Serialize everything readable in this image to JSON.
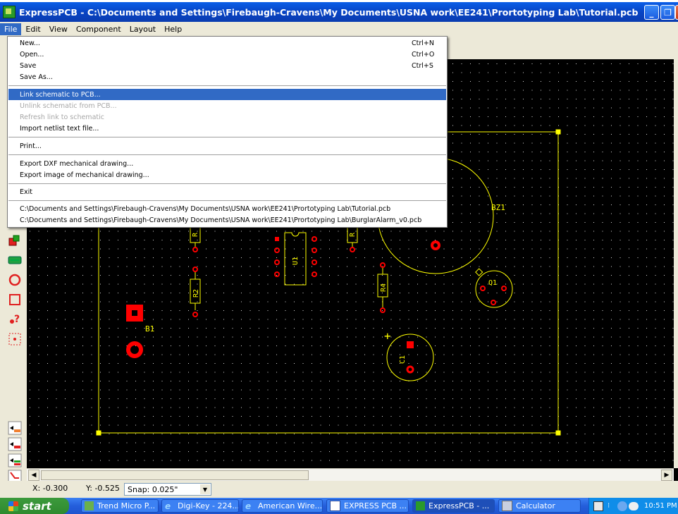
{
  "window": {
    "title": "ExpressPCB - C:\\Documents and Settings\\Firebaugh-Cravens\\My Documents\\USNA work\\EE241\\Prortotyping Lab\\Tutorial.pcb",
    "min_glyph": "_",
    "max_glyph": "❐",
    "close_glyph": "✕"
  },
  "menubar": {
    "items": [
      "File",
      "Edit",
      "View",
      "Component",
      "Layout",
      "Help"
    ]
  },
  "file_menu": {
    "items": [
      {
        "label": "New...",
        "shortcut": "Ctrl+N",
        "state": "normal"
      },
      {
        "label": "Open...",
        "shortcut": "Ctrl+O",
        "state": "normal"
      },
      {
        "label": "Save",
        "shortcut": "Ctrl+S",
        "state": "normal"
      },
      {
        "label": "Save As...",
        "shortcut": "",
        "state": "normal"
      },
      {
        "label": "Link schematic to PCB...",
        "shortcut": "",
        "state": "highlighted"
      },
      {
        "label": "Unlink schematic from PCB...",
        "shortcut": "",
        "state": "disabled"
      },
      {
        "label": "Refresh link to schematic",
        "shortcut": "",
        "state": "disabled"
      },
      {
        "label": "Import netlist text file...",
        "shortcut": "",
        "state": "normal"
      },
      {
        "label": "Print...",
        "shortcut": "",
        "state": "normal"
      },
      {
        "label": "Export DXF mechanical drawing...",
        "shortcut": "",
        "state": "normal"
      },
      {
        "label": "Export image of mechanical drawing...",
        "shortcut": "",
        "state": "normal"
      },
      {
        "label": "Exit",
        "shortcut": "",
        "state": "normal"
      },
      {
        "label": "C:\\Documents and Settings\\Firebaugh-Cravens\\My Documents\\USNA work\\EE241\\Prortotyping Lab\\Tutorial.pcb",
        "shortcut": "",
        "state": "normal"
      },
      {
        "label": "C:\\Documents and Settings\\Firebaugh-Cravens\\My Documents\\USNA work\\EE241\\Prortotyping Lab\\BurglarAlarm_v0.pcb",
        "shortcut": "",
        "state": "normal"
      }
    ]
  },
  "pcb": {
    "labels": {
      "bz1": "BZ1",
      "r2": "R2",
      "r4": "R4",
      "u1": "U1",
      "q1": "Q1",
      "c1": "C1",
      "b1": "B1",
      "r_left": "R",
      "r_right": "R",
      "plus": "+"
    },
    "colors": {
      "silkscreen": "#ffff00",
      "pad": "#ff0000",
      "grid": "#d8d8d8",
      "background": "#000000"
    }
  },
  "status": {
    "x": "X: -0.300",
    "y": "Y: -0.525",
    "snap": "Snap:  0.025\""
  },
  "taskbar": {
    "start": "start",
    "tasks": [
      {
        "label": "Trend Micro P...",
        "icon": "trend-micro-icon"
      },
      {
        "label": "Digi-Key - 224...",
        "icon": "ie-icon"
      },
      {
        "label": "American Wire...",
        "icon": "ie-icon"
      },
      {
        "label": "EXPRESS PCB ...",
        "icon": "word-icon"
      },
      {
        "label": "ExpressPCB - ...",
        "icon": "expresspcb-icon"
      },
      {
        "label": "Calculator",
        "icon": "calculator-icon"
      }
    ],
    "clock": "10:51 PM"
  }
}
